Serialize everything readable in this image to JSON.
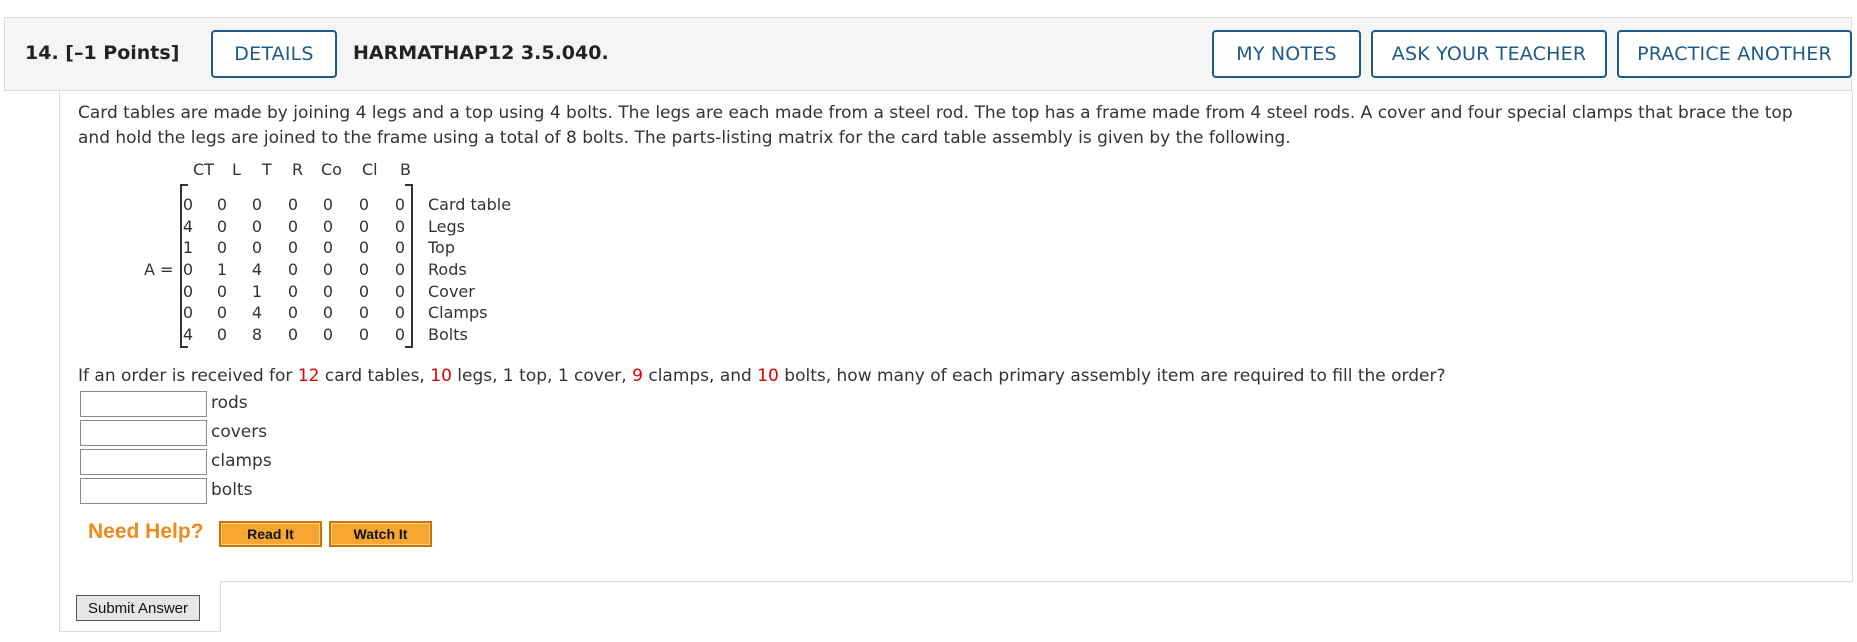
{
  "header": {
    "question_label": "14.  [–1 Points]",
    "details_label": "DETAILS",
    "code": "HARMATHAP12 3.5.040.",
    "my_notes_label": "MY NOTES",
    "ask_teacher_label": "ASK YOUR TEACHER",
    "practice_another_label": "PRACTICE ANOTHER",
    "accent_color": "#1e5a8c"
  },
  "problem": {
    "text": "Card tables are made by joining 4 legs and a top using 4 bolts. The legs are each made from a steel rod. The top has a frame made from 4 steel rods. A cover and four special clamps that brace the top and hold the legs are joined to the frame using a total of 8 bolts. The parts-listing matrix for the card table assembly is given by the following."
  },
  "matrix": {
    "label": "A =",
    "columns": [
      "CT",
      "L",
      "T",
      "R",
      "Co",
      "Cl",
      "B"
    ],
    "row_labels": [
      "Card table",
      "Legs",
      "Top",
      "Rods",
      "Cover",
      "Clamps",
      "Bolts"
    ],
    "rows": [
      [
        "0",
        "0",
        "0",
        "0",
        "0",
        "0",
        "0"
      ],
      [
        "4",
        "0",
        "0",
        "0",
        "0",
        "0",
        "0"
      ],
      [
        "1",
        "0",
        "0",
        "0",
        "0",
        "0",
        "0"
      ],
      [
        "0",
        "1",
        "4",
        "0",
        "0",
        "0",
        "0"
      ],
      [
        "0",
        "0",
        "1",
        "0",
        "0",
        "0",
        "0"
      ],
      [
        "0",
        "0",
        "4",
        "0",
        "0",
        "0",
        "0"
      ],
      [
        "4",
        "0",
        "8",
        "0",
        "0",
        "0",
        "0"
      ]
    ]
  },
  "question": {
    "p1": "If an order is received for ",
    "n1": "12",
    "p2": " card tables, ",
    "n2": "10",
    "p3": " legs, 1 top, 1 cover, ",
    "n3": "9",
    "p4": " clamps, and ",
    "n4": "10",
    "p5": " bolts, how many of each primary assembly item are required to fill the order?",
    "highlight_color": "#e00000"
  },
  "answers": [
    {
      "label": "rods",
      "value": ""
    },
    {
      "label": "covers",
      "value": ""
    },
    {
      "label": "clamps",
      "value": ""
    },
    {
      "label": "bolts",
      "value": ""
    }
  ],
  "help": {
    "label": "Need Help?",
    "read_it": "Read It",
    "watch_it": "Watch It"
  },
  "submit_label": "Submit Answer"
}
